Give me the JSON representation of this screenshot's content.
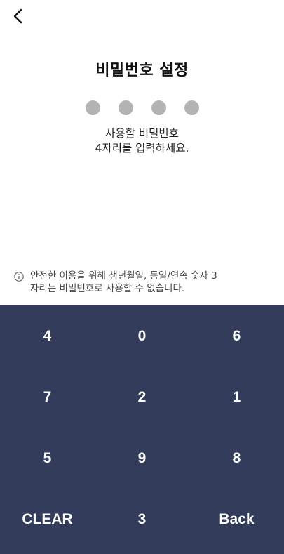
{
  "header": {
    "back_icon": "chevron-left-icon"
  },
  "title": "비밀번호 설정",
  "pin": {
    "length": 4,
    "entered": 0,
    "dot_color": "#b3b3b3"
  },
  "instruction": {
    "line1": "사용할 비밀번호",
    "line2": "4자리를 입력하세요."
  },
  "notice": {
    "icon": "info-icon",
    "line1": "안전한 이용을 위해 생년월일, 동일/연속 숫자 3",
    "line2": "자리는 비밀번호로 사용할 수 없습니다."
  },
  "keypad": {
    "background": "#333d5b",
    "keys": [
      [
        "4",
        "0",
        "6"
      ],
      [
        "7",
        "2",
        "1"
      ],
      [
        "5",
        "9",
        "8"
      ],
      [
        "CLEAR",
        "3",
        "Back"
      ]
    ]
  }
}
